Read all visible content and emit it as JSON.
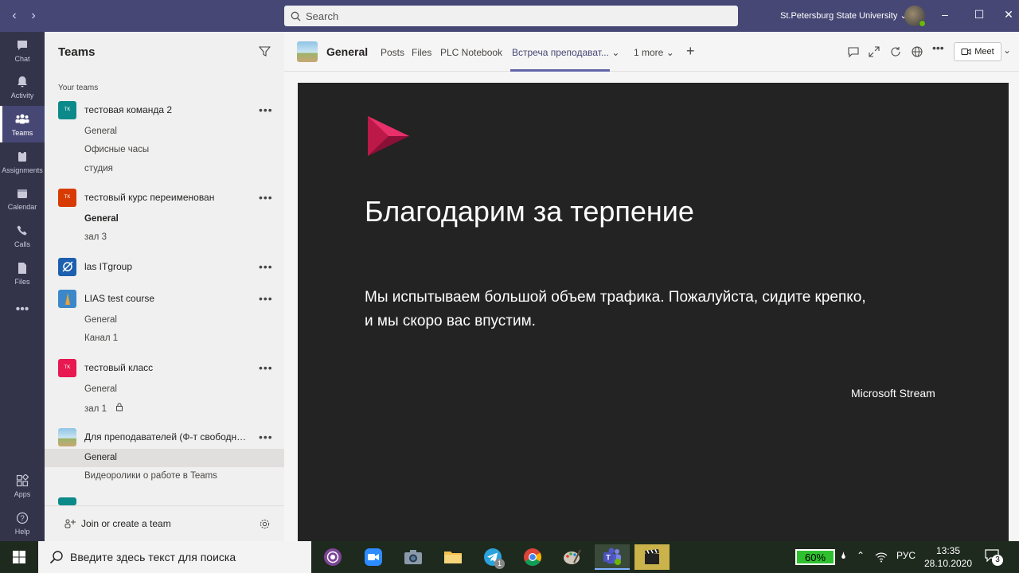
{
  "titlebar": {
    "search_placeholder": "Search",
    "org_name": "St.Petersburg State University",
    "back_glyph": "‹",
    "forward_glyph": "›"
  },
  "rail": [
    {
      "label": "Chat",
      "icon": "chat-icon"
    },
    {
      "label": "Activity",
      "icon": "bell-icon"
    },
    {
      "label": "Teams",
      "icon": "teams-icon",
      "active": true
    },
    {
      "label": "Assignments",
      "icon": "assignments-icon"
    },
    {
      "label": "Calendar",
      "icon": "calendar-icon"
    },
    {
      "label": "Calls",
      "icon": "phone-icon"
    },
    {
      "label": "Files",
      "icon": "file-icon"
    },
    {
      "label": "Apps",
      "icon": "apps-icon"
    },
    {
      "label": "Help",
      "icon": "help-icon"
    }
  ],
  "panel": {
    "title": "Teams",
    "section_label": "Your teams",
    "join_label": "Join or create a team",
    "teams": [
      {
        "name": "тестовая команда 2",
        "tile_text": "TK",
        "tile_color": "#0c8a8a",
        "channels": [
          "General",
          "Офисные часы",
          "студия"
        ]
      },
      {
        "name": "тестовый курс переименован",
        "tile_text": "TK",
        "tile_color": "#d83b01",
        "channels": [
          "General",
          "зал 3"
        ]
      },
      {
        "name": "las ITgroup",
        "tile_text": "",
        "tile_color": "#1b5fae",
        "channels": []
      },
      {
        "name": "LIAS test course",
        "tile_text": "",
        "tile_color": "#3a87c9",
        "channels": [
          "General",
          "Канал 1"
        ]
      },
      {
        "name": "тестовый класс",
        "tile_text": "TK",
        "tile_color": "#e81850",
        "channels": [
          "General",
          "зал 1"
        ]
      },
      {
        "name": "Для преподавателей (Ф-т свободных...",
        "tile_text": "",
        "tile_color": "#8fc4e6",
        "channels": [
          "General",
          "Видеоролики о работе в Teams"
        ]
      }
    ]
  },
  "channel_header": {
    "title": "General",
    "tabs": [
      "Posts",
      "Files",
      "PLC Notebook",
      "Встреча преподават...",
      "1 more"
    ],
    "meet_label": "Meet"
  },
  "stream": {
    "heading": "Благодарим за терпение",
    "body": "Мы испытываем большой объем трафика. Пожалуйста, сидите крепко, и мы скоро вас впустим.",
    "brand": "Microsoft Stream"
  },
  "taskbar": {
    "search_placeholder": "Введите здесь текст для поиска",
    "battery": "60%",
    "language": "РУС",
    "time": "13:35",
    "date": "28.10.2020",
    "notifications": "3",
    "telegram_badge": "1"
  }
}
